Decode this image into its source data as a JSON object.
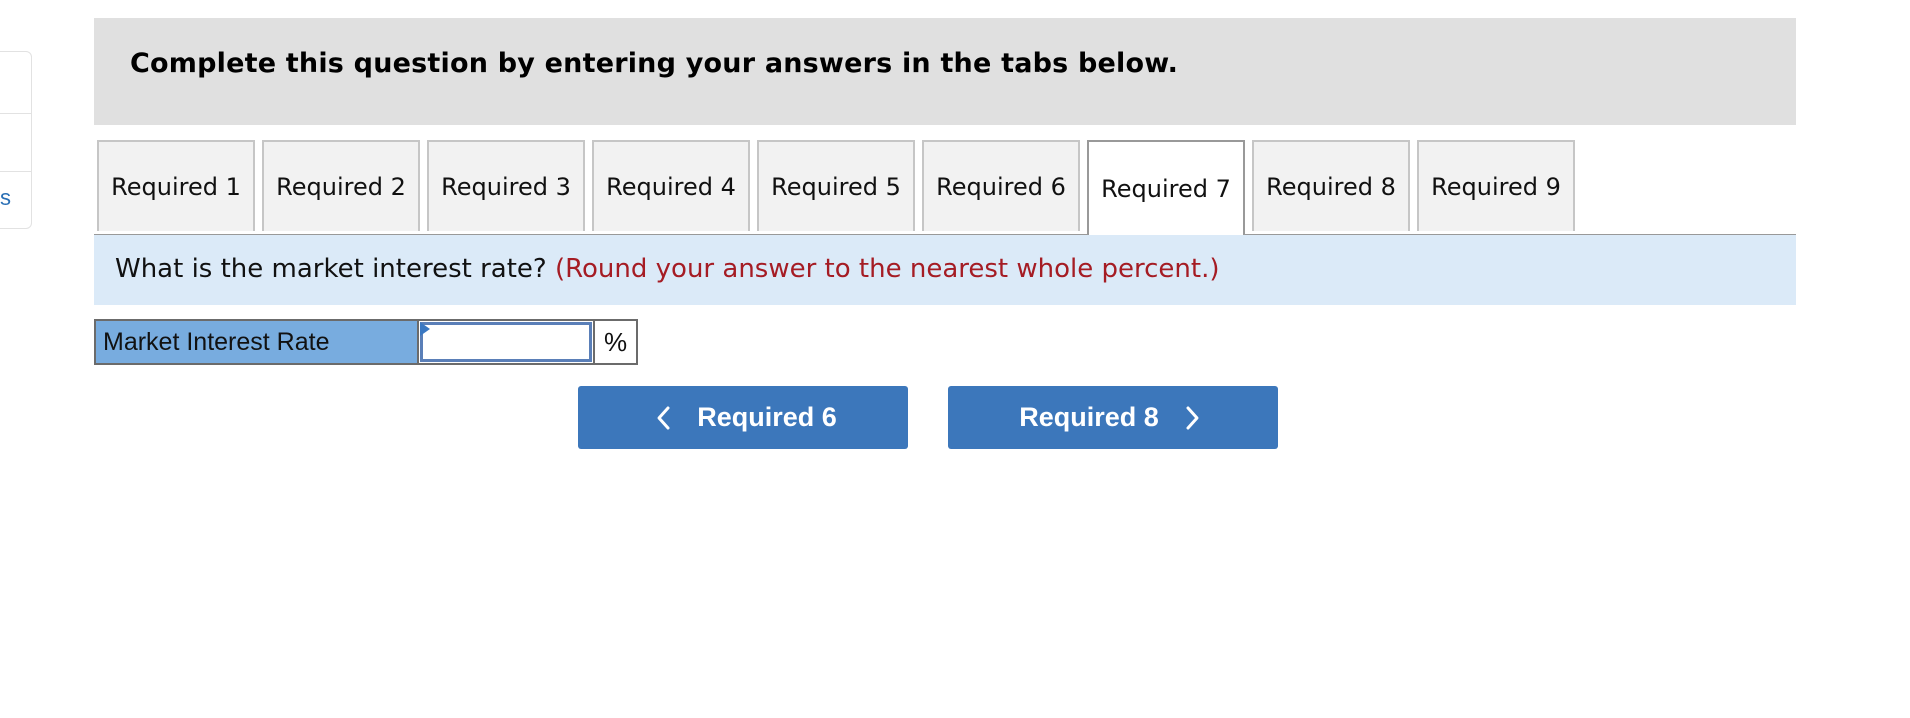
{
  "sidebar": {
    "partial_link_text": "s"
  },
  "header": {
    "title": "Complete this question by entering your answers in the tabs below."
  },
  "tabs": [
    {
      "label": "Required 1",
      "active": false
    },
    {
      "label": "Required 2",
      "active": false
    },
    {
      "label": "Required 3",
      "active": false
    },
    {
      "label": "Required 4",
      "active": false
    },
    {
      "label": "Required 5",
      "active": false
    },
    {
      "label": "Required 6",
      "active": false
    },
    {
      "label": "Required 7",
      "active": true
    },
    {
      "label": "Required 8",
      "active": false
    },
    {
      "label": "Required 9",
      "active": false
    }
  ],
  "question": {
    "text": "What is the market interest rate?",
    "note": "(Round your answer to the nearest whole percent.)"
  },
  "answer": {
    "label": "Market Interest Rate",
    "value": "",
    "unit": "%"
  },
  "navigation": {
    "prev_label": "Required 6",
    "next_label": "Required 8"
  },
  "colors": {
    "header_bg": "#e0e0e0",
    "question_bg": "#dbeaf8",
    "note_red": "#a51c24",
    "label_blue": "#78acdf",
    "button_blue": "#3c77bb"
  }
}
